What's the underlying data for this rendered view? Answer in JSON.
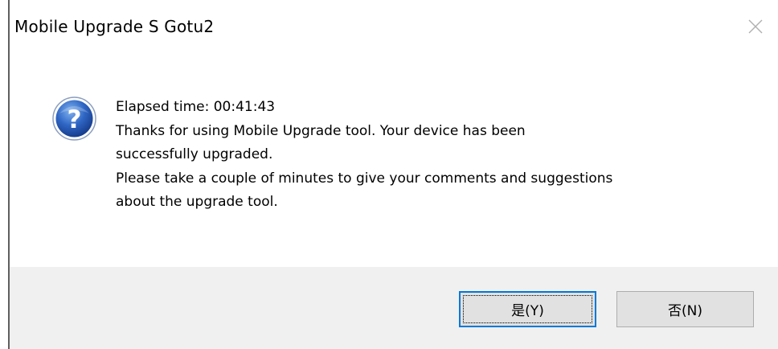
{
  "window": {
    "title": "Mobile Upgrade S Gotu2",
    "close_icon": "close-icon"
  },
  "dialog": {
    "icon": "question-icon",
    "lines": [
      "Elapsed time: 00:41:43",
      "Thanks for using Mobile Upgrade tool. Your device has been",
      "successfully upgraded.",
      "Please take a couple of minutes to give your comments and suggestions",
      "about the upgrade tool."
    ]
  },
  "buttons": {
    "yes_label": "是(Y)",
    "no_label": "否(N)"
  },
  "colors": {
    "footer_bg": "#f0f0f0",
    "button_bg": "#e1e1e1",
    "focus_border": "#0078d7",
    "icon_blue": "#2a5db0"
  }
}
